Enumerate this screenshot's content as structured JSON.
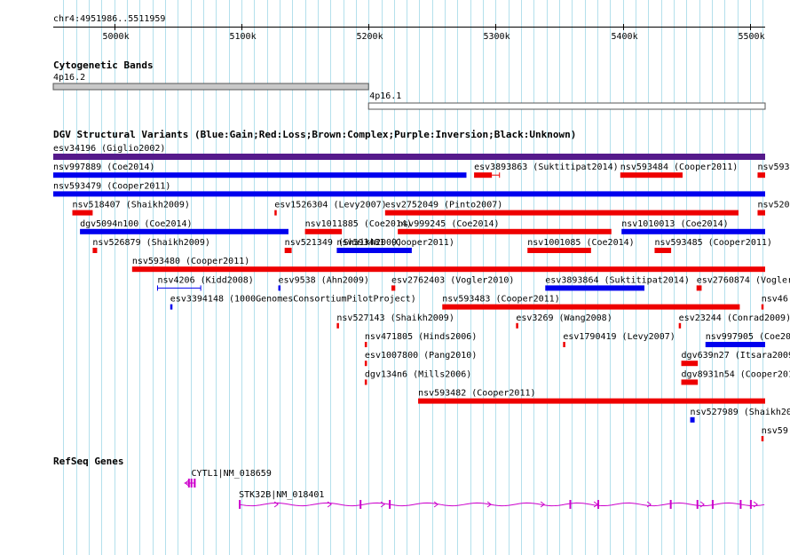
{
  "header": {
    "region": "chr4:4951986..5511959",
    "ticks": [
      {
        "label": "5000k",
        "pos": 5000000
      },
      {
        "label": "5100k",
        "pos": 5100000
      },
      {
        "label": "5200k",
        "pos": 5200000
      },
      {
        "label": "5300k",
        "pos": 5300000
      },
      {
        "label": "5400k",
        "pos": 5400000
      },
      {
        "label": "5500k",
        "pos": 5500000
      }
    ]
  },
  "view": {
    "start": 4951986,
    "end": 5511959
  },
  "cytobands": {
    "title": "Cytogenetic Bands",
    "bands": [
      {
        "name": "4p16.2",
        "start": 4951986,
        "end": 5200000,
        "color": "#c8c8c8",
        "label_row": 0
      },
      {
        "name": "4p16.1",
        "start": 5200000,
        "end": 5511959,
        "color": "#ffffff",
        "label_row": 1
      }
    ]
  },
  "colors": {
    "gain": "#0000ee",
    "loss": "#ee0000",
    "complex": "#8b4513",
    "inversion": "#551a8b",
    "unknown": "#000000",
    "gene": "#cc00cc",
    "grid": "#b4e0ec"
  },
  "dgv": {
    "title": "DGV Structural Variants (Blue:Gain;Red:Loss;Brown:Complex;Purple:Inversion;Black:Unknown)",
    "variants": [
      {
        "label": "esv34196 (Giglio2002)",
        "start": 4951986,
        "end": 5511959,
        "type": "inversion",
        "row": 0,
        "thick": true
      },
      {
        "label": "nsv997889 (Coe2014)",
        "start": 4951986,
        "end": 5277000,
        "type": "gain",
        "row": 1
      },
      {
        "label": "esv3893863 (Suktitipat2014)",
        "start": 5283000,
        "end": 5297000,
        "type": "loss",
        "row": 1,
        "tail": 5303000
      },
      {
        "label": "nsv593484 (Cooper2011)",
        "start": 5398000,
        "end": 5447000,
        "type": "loss",
        "row": 1
      },
      {
        "label": "nsv593",
        "start": 5506000,
        "end": 5511959,
        "type": "loss",
        "row": 1
      },
      {
        "label": "nsv593479 (Cooper2011)",
        "start": 4951986,
        "end": 5511959,
        "type": "gain",
        "row": 2
      },
      {
        "label": "nsv518407 (Shaikh2009)",
        "start": 4967000,
        "end": 4983000,
        "type": "loss",
        "row": 3
      },
      {
        "label": "esv1526304 (Levy2007)",
        "start": 5126000,
        "end": 5127500,
        "type": "loss",
        "row": 3
      },
      {
        "label": "esv2752049 (Pinto2007)",
        "start": 5213000,
        "end": 5491000,
        "type": "loss",
        "row": 3
      },
      {
        "label": "nsv520",
        "start": 5506000,
        "end": 5511959,
        "type": "loss",
        "row": 3
      },
      {
        "label": "dgv5094n100 (Coe2014)",
        "start": 4973000,
        "end": 5137000,
        "type": "gain",
        "row": 4
      },
      {
        "label": "nsv1011885 (Coe2014)",
        "start": 5150000,
        "end": 5179000,
        "type": "loss",
        "row": 4
      },
      {
        "label": "nsv999245 (Coe2014)",
        "start": 5223000,
        "end": 5391000,
        "type": "loss",
        "row": 4
      },
      {
        "label": "nsv1010013 (Coe2014)",
        "start": 5399000,
        "end": 5511959,
        "type": "gain",
        "row": 4
      },
      {
        "label": "nsv526879 (Shaikh2009)",
        "start": 4983000,
        "end": 4986500,
        "type": "loss",
        "row": 5
      },
      {
        "label": "nsv521349 (Shaikh2009)",
        "start": 5134000,
        "end": 5139500,
        "type": "loss",
        "row": 5
      },
      {
        "label": "nsv593481 (Cooper2011)",
        "start": 5175000,
        "end": 5234000,
        "type": "gain",
        "row": 5
      },
      {
        "label": "nsv1001085 (Coe2014)",
        "start": 5325000,
        "end": 5375000,
        "type": "loss",
        "row": 5
      },
      {
        "label": "nsv593485 (Cooper2011)",
        "start": 5425000,
        "end": 5438000,
        "type": "loss",
        "row": 5
      },
      {
        "label": "nsv593480 (Cooper2011)",
        "start": 5014000,
        "end": 5511959,
        "type": "loss",
        "row": 6
      },
      {
        "label": "nsv4206 (Kidd2008)",
        "start": 5034000,
        "end": 5068000,
        "type": "gain",
        "row": 7,
        "thin": true
      },
      {
        "label": "esv9538 (Ahn2009)",
        "start": 5129000,
        "end": 5130500,
        "type": "gain",
        "row": 7
      },
      {
        "label": "esv2762403 (Vogler2010)",
        "start": 5218000,
        "end": 5221000,
        "type": "loss",
        "row": 7
      },
      {
        "label": "esv3893864 (Suktitipat2014)",
        "start": 5339000,
        "end": 5417000,
        "type": "gain",
        "row": 7
      },
      {
        "label": "esv2760874 (Vogler",
        "start": 5458000,
        "end": 5462000,
        "type": "loss",
        "row": 7
      },
      {
        "label": "esv3394148 (1000GenomesConsortiumPilotProject)",
        "start": 5044000,
        "end": 5045500,
        "type": "gain",
        "row": 8
      },
      {
        "label": "nsv593483 (Cooper2011)",
        "start": 5258000,
        "end": 5492000,
        "type": "loss",
        "row": 8
      },
      {
        "label": "nsv46",
        "start": 5509000,
        "end": 5510500,
        "type": "loss",
        "row": 8
      },
      {
        "label": "nsv527143 (Shaikh2009)",
        "start": 5175000,
        "end": 5176500,
        "type": "loss",
        "row": 9
      },
      {
        "label": "esv3269 (Wang2008)",
        "start": 5316000,
        "end": 5317500,
        "type": "loss",
        "row": 9
      },
      {
        "label": "esv23244 (Conrad2009)",
        "start": 5444000,
        "end": 5445500,
        "type": "loss",
        "row": 9
      },
      {
        "label": "nsv471805 (Hinds2006)",
        "start": 5197000,
        "end": 5198500,
        "type": "loss",
        "row": 10
      },
      {
        "label": "esv1790419 (Levy2007)",
        "start": 5353000,
        "end": 5354500,
        "type": "loss",
        "row": 10
      },
      {
        "label": "nsv997905 (Coe20",
        "start": 5465000,
        "end": 5511959,
        "type": "gain",
        "row": 10
      },
      {
        "label": "esv1007800 (Pang2010)",
        "start": 5197000,
        "end": 5198500,
        "type": "loss",
        "row": 11
      },
      {
        "label": "dgv639n27 (Itsara2009)",
        "start": 5446000,
        "end": 5459000,
        "type": "loss",
        "row": 11
      },
      {
        "label": "dgv134n6 (Mills2006)",
        "start": 5197000,
        "end": 5198500,
        "type": "loss",
        "row": 12
      },
      {
        "label": "dgv8931n54 (Cooper2011",
        "start": 5446000,
        "end": 5459000,
        "type": "loss",
        "row": 12
      },
      {
        "label": "nsv593482 (Cooper2011)",
        "start": 5239000,
        "end": 5511959,
        "type": "loss",
        "row": 13
      },
      {
        "label": "nsv527989 (Shaikh2009",
        "start": 5453000,
        "end": 5456500,
        "type": "gain",
        "row": 14
      },
      {
        "label": "nsv59",
        "start": 5509000,
        "end": 5510500,
        "type": "loss",
        "row": 15
      }
    ]
  },
  "refseq": {
    "title": "RefSeq Genes",
    "genes": [
      {
        "label": "CYTL1|NM_018659",
        "start": 5055000,
        "end": 5064000,
        "row": 0,
        "strand": "-",
        "exons": [
          [
            5058000,
            5059000
          ],
          [
            5060000,
            5061000
          ],
          [
            5062500,
            5064000
          ]
        ]
      },
      {
        "label": "STK32B|NM_018401",
        "start": 5098000,
        "end": 5511959,
        "row": 1,
        "strand": "+",
        "exons": [
          [
            5098000,
            5099000
          ],
          [
            5193000,
            5194000
          ],
          [
            5216000,
            5217000
          ],
          [
            5358000,
            5359000
          ],
          [
            5380000,
            5381000
          ],
          [
            5437000,
            5438000
          ],
          [
            5458000,
            5459000
          ],
          [
            5470000,
            5471000
          ],
          [
            5492000,
            5493000
          ],
          [
            5500000,
            5501000
          ]
        ]
      }
    ]
  }
}
